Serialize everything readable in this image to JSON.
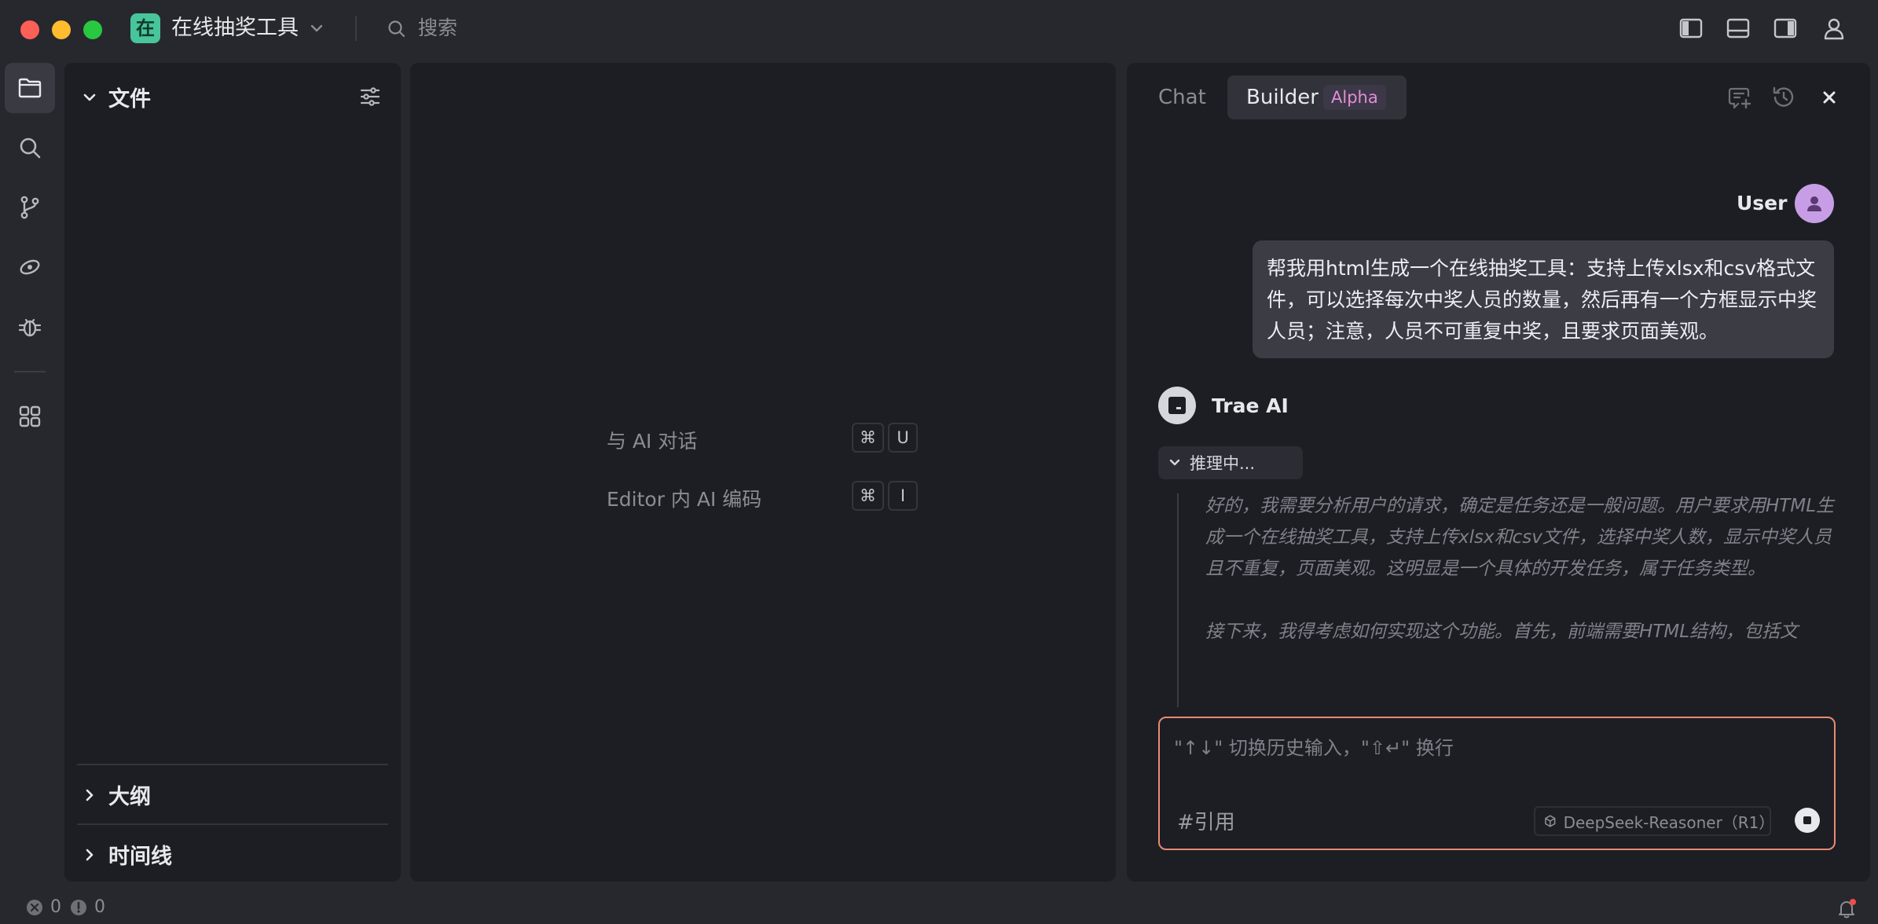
{
  "window": {
    "project_initial": "在",
    "project_name": "在线抽奖工具",
    "search_placeholder": "搜索"
  },
  "explorer": {
    "files_label": "文件",
    "outline_label": "大纲",
    "timeline_label": "时间线"
  },
  "editor": {
    "shortcuts": [
      {
        "label": "与 AI 对话",
        "keys": [
          "⌘",
          "U"
        ]
      },
      {
        "label": "Editor 内 AI 编码",
        "keys": [
          "⌘",
          "I"
        ]
      }
    ]
  },
  "chat": {
    "tabs": {
      "chat": "Chat",
      "builder": "Builder",
      "builder_badge": "Alpha"
    },
    "user_name": "User",
    "user_message": "帮我用html生成一个在线抽奖工具：支持上传xlsx和csv格式文件，可以选择每次中奖人员的数量，然后再有一个方框显示中奖人员；注意，人员不可重复中奖，且要求页面美观。",
    "ai_name": "Trae AI",
    "reasoning_label": "推理中...",
    "reasoning_paragraphs": [
      "好的，我需要分析用户的请求，确定是任务还是一般问题。用户要求用HTML生成一个在线抽奖工具，支持上传xlsx和csv文件，选择中奖人数，显示中奖人员且不重复，页面美观。这明显是一个具体的开发任务，属于任务类型。",
      "接下来，我得考虑如何实现这个功能。首先，前端需要HTML结构，包括文"
    ],
    "input_placeholder": "\"↑↓\" 切换历史输入，\"⇧↵\" 换行",
    "reference_label": "#引用",
    "model_name": "DeepSeek-Reasoner（R1）"
  },
  "status": {
    "errors": "0",
    "warnings": "0"
  },
  "colors": {
    "project_logo": "#48c59a",
    "input_border": "#e88a74",
    "alpha_badge_text": "#e08fd4",
    "user_avatar": "#c79ee6"
  }
}
